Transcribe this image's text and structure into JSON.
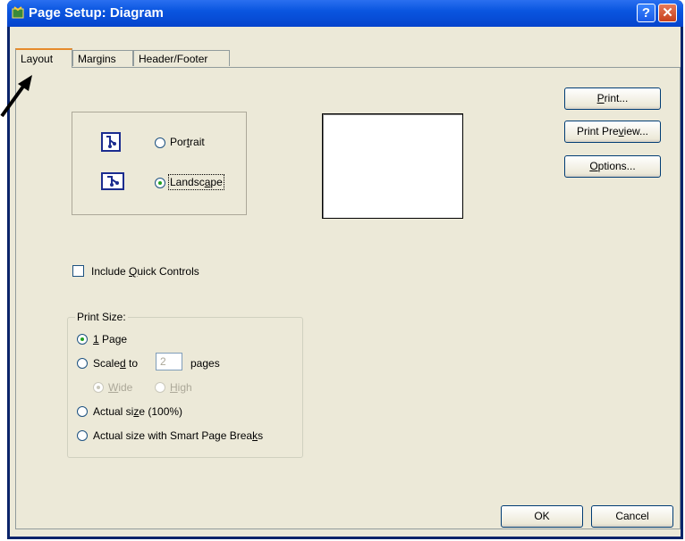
{
  "window": {
    "title": "Page Setup: Diagram",
    "help_label": "?",
    "close_label": "✕"
  },
  "tabs": [
    "Layout",
    "Margins",
    "Header/Footer"
  ],
  "orientation": {
    "portrait": {
      "pre": "Por",
      "key": "t",
      "post": "rait",
      "checked": false
    },
    "landscape": {
      "pre": "Landsc",
      "key": "a",
      "post": "pe",
      "checked": true
    }
  },
  "side_buttons": {
    "print": {
      "pre": "",
      "key": "P",
      "post": "rint..."
    },
    "print_preview": {
      "pre": "Print Pre",
      "key": "v",
      "post": "iew..."
    },
    "options": {
      "pre": "",
      "key": "O",
      "post": "ptions..."
    }
  },
  "quick_controls": {
    "pre": "Include ",
    "key": "Q",
    "post": "uick Controls",
    "checked": false
  },
  "print_size": {
    "title": "Print Size:",
    "one_page": {
      "pre": "",
      "key": "1",
      "post": " Page",
      "checked": true
    },
    "scaled_to": {
      "pre": "Scale",
      "key": "d",
      "post": " to",
      "value": "2",
      "unit": "pages",
      "checked": false
    },
    "wide": {
      "pre": "",
      "key": "W",
      "post": "ide",
      "checked": true
    },
    "high": {
      "pre": "",
      "key": "H",
      "post": "igh",
      "checked": false
    },
    "actual_size": {
      "pre": "Actual si",
      "key": "z",
      "post": "e (100%)",
      "checked": false
    },
    "actual_smart": {
      "pre": "Actual size with Smart Page Brea",
      "key": "k",
      "post": "s",
      "checked": false
    }
  },
  "footer": {
    "ok": "OK",
    "cancel": "Cancel"
  }
}
